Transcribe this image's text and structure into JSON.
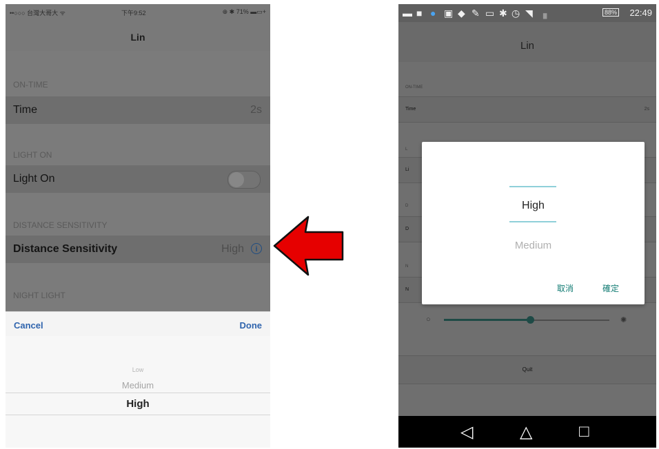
{
  "ios": {
    "status": {
      "carrier": "••○○○ 台灣大哥大 ᯤ",
      "time": "下午9:52",
      "battery": "⊕ ✱ 71% ▬▭+"
    },
    "title": "Lin",
    "sections": [
      {
        "header": "ON-TIME",
        "row_label": "Time",
        "row_value": "2s"
      },
      {
        "header": "LIGHT ON",
        "row_label": "Light On",
        "toggle_on": false
      },
      {
        "header": "DISTANCE SENSITIVITY",
        "row_label": "Distance Sensitivity",
        "row_value": "High",
        "info_icon": "ⓘ"
      },
      {
        "header": "NIGHT LIGHT"
      }
    ],
    "cancel": "Cancel",
    "done": "Done",
    "picker": {
      "options": [
        "Low",
        "Medium",
        "High"
      ],
      "selected": "High"
    }
  },
  "android": {
    "status": {
      "time": "22:49",
      "battery": "88%"
    },
    "title": "Lin",
    "rows": [
      {
        "header": "ON-TIME",
        "label": "Time",
        "value": "2s"
      },
      {
        "header": "L",
        "label": "Li"
      },
      {
        "header": "D",
        "label": "D"
      },
      {
        "header": "N",
        "label": "N"
      }
    ],
    "dialog": {
      "options": [
        "High",
        "Medium"
      ],
      "selected": "High",
      "cancel": "取消",
      "confirm": "確定"
    },
    "slider": {
      "level": 0.52
    },
    "quit": "Quit"
  },
  "colors": {
    "arrow": "#e60000",
    "ios_accent": "#2f64ad",
    "android_accent": "#137c74"
  }
}
